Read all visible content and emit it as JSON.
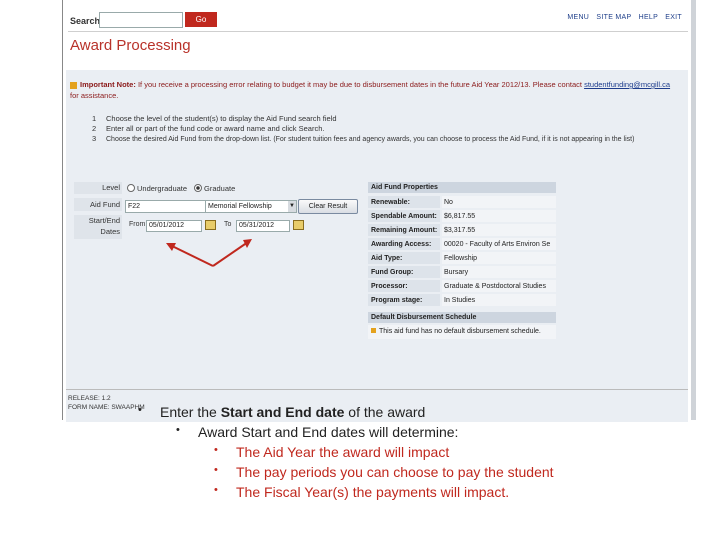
{
  "topbar": {
    "search_label": "Search",
    "search_value": "",
    "go_label": "Go",
    "nav": [
      "MENU",
      "SITE MAP",
      "HELP",
      "EXIT"
    ]
  },
  "page_title": "Award Processing",
  "note": {
    "label": "Important Note:",
    "text": "If you receive a processing error relating to budget it may be due to disbursement dates in the future Aid Year 2012/13. Please contact",
    "link": "studentfunding@mcgill.ca",
    "suffix": "for assistance."
  },
  "steps": [
    {
      "n": "1",
      "text": "Choose the level of the student(s) to display the Aid Fund search field"
    },
    {
      "n": "2",
      "text": "Enter all or part of the fund code or award name and click Search."
    },
    {
      "n": "3",
      "text": "Choose the desired Aid Fund from the drop-down list. (For student tuition fees and agency awards, you can choose to process the Aid Fund, if it is not appearing in the list)"
    }
  ],
  "form": {
    "level_label": "Level",
    "level_options": [
      "Undergraduate",
      "Graduate"
    ],
    "aid_fund_label": "Aid Fund",
    "aid_fund_value": "F22",
    "aid_fund_select": "Memorial Fellowship",
    "clear_label": "Clear Result",
    "dates_label_1": "Start/End",
    "dates_label_2": "Dates",
    "from_label": "From",
    "from_value": "05/01/2012",
    "to_label": "To",
    "to_value": "05/31/2012"
  },
  "properties": {
    "header": "Aid Fund Properties",
    "rows": [
      {
        "k": "Renewable:",
        "v": "No"
      },
      {
        "k": "Spendable Amount:",
        "v": "$6,817.55"
      },
      {
        "k": "Remaining Amount:",
        "v": "$3,317.55"
      },
      {
        "k": "Awarding Access:",
        "v": "00020 - Faculty of Arts Environ Se"
      },
      {
        "k": "Aid Type:",
        "v": "Fellowship"
      },
      {
        "k": "Fund Group:",
        "v": "Bursary"
      },
      {
        "k": "Processor:",
        "v": "Graduate & Postdoctoral Studies"
      },
      {
        "k": "Program stage:",
        "v": "In Studies"
      }
    ],
    "schedule_header": "Default Disbursement Schedule",
    "schedule_text": "This aid fund has no default disbursement schedule."
  },
  "release": {
    "line1": "RELEASE: 1.2",
    "line2": "FORM NAME: SWAAPHM"
  },
  "bullets": {
    "b1_pre": "Enter the ",
    "b1_bold": "Start and End date",
    "b1_post": " of the award",
    "b2": "Award Start and End dates will determine:",
    "b3": [
      "The Aid Year the award will impact",
      "The pay periods you can choose to pay the student",
      "The Fiscal Year(s) the payments will impact."
    ]
  },
  "colors": {
    "accent_red": "#c0281e",
    "title_red": "#b8322a",
    "link_blue": "#1d3c8c",
    "panel_bg": "#eaeef3"
  }
}
